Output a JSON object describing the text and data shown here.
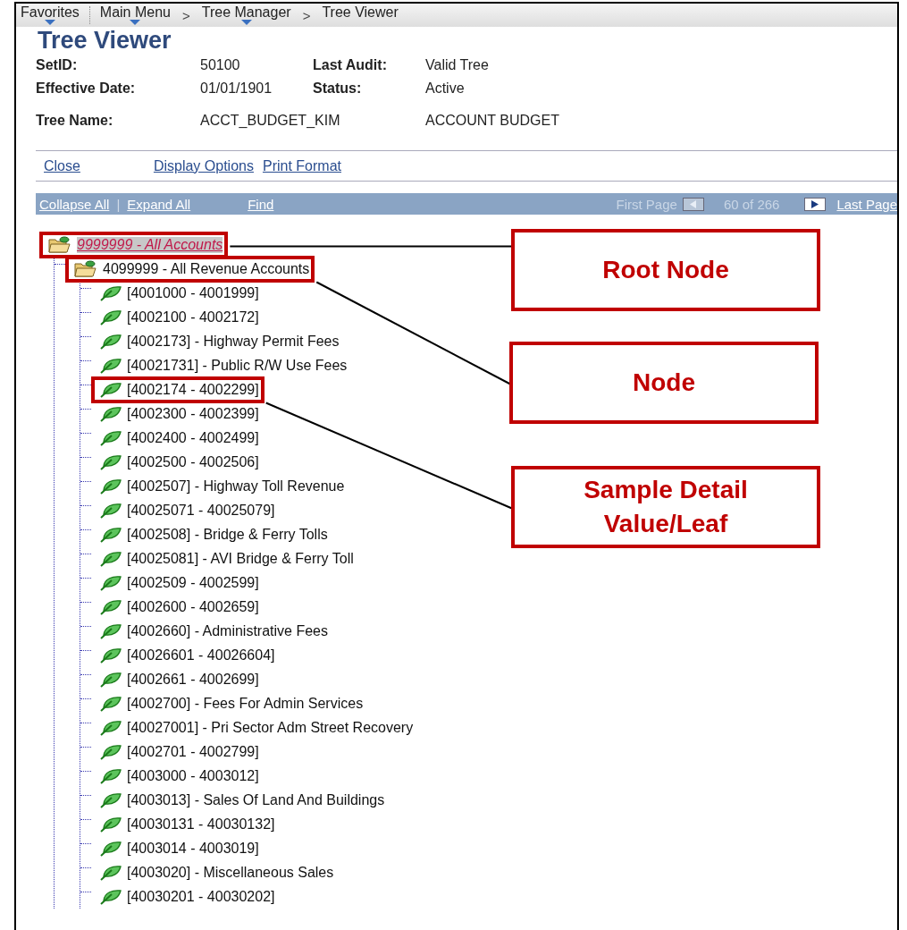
{
  "nav": [
    {
      "label": "Favorites",
      "dropdown": true,
      "divider": true
    },
    {
      "label": "Main Menu",
      "dropdown": true,
      "divider": false,
      "separator": ">"
    },
    {
      "label": "Tree Manager",
      "dropdown": true,
      "divider": false,
      "separator": ">"
    },
    {
      "label": "Tree Viewer",
      "dropdown": false,
      "divider": false
    }
  ],
  "title": "Tree Viewer",
  "fields": [
    {
      "label": "SetID:",
      "value": "50100",
      "label2": "Last Audit:",
      "value2": "Valid Tree"
    },
    {
      "label": "Effective Date:",
      "value": "01/01/1901",
      "label2": "Status:",
      "value2": "Active"
    },
    {
      "label": "Tree Name:",
      "value": "ACCT_BUDGET_KIM",
      "value2": "ACCOUNT BUDGET"
    }
  ],
  "actions": [
    {
      "label": "Close"
    },
    {
      "label": "Display Options"
    },
    {
      "label": "Print Format"
    }
  ],
  "toolbar": {
    "links": [
      {
        "label": "Collapse All"
      },
      {
        "label": "Expand All"
      },
      {
        "label": "Find"
      }
    ],
    "divider": "|",
    "first_page": {
      "label": "First Page",
      "disabled": true
    },
    "prev_disabled": true,
    "counter": "60 of 266",
    "next_disabled": false,
    "last_page": {
      "label": "Last Page",
      "disabled": false
    }
  },
  "tree": {
    "kind": "folder",
    "label": "9999999 - All Accounts",
    "selected": true,
    "highlighted": true,
    "children": [
      {
        "kind": "folder",
        "label": "4099999 - All Revenue Accounts",
        "selected": false,
        "highlighted": true,
        "children": [
          {
            "kind": "leaf",
            "label": "[4001000 - 4001999]",
            "selected": false,
            "highlighted": false
          },
          {
            "kind": "leaf",
            "label": "[4002100 - 4002172]",
            "selected": false,
            "highlighted": false
          },
          {
            "kind": "leaf",
            "label": "[4002173] - Highway Permit Fees",
            "selected": false,
            "highlighted": false
          },
          {
            "kind": "leaf",
            "label": "[40021731] - Public R/W Use Fees",
            "selected": false,
            "highlighted": false
          },
          {
            "kind": "leaf",
            "label": "[4002174 - 4002299]",
            "selected": false,
            "highlighted": true
          },
          {
            "kind": "leaf",
            "label": "[4002300 - 4002399]",
            "selected": false,
            "highlighted": false
          },
          {
            "kind": "leaf",
            "label": "[4002400 - 4002499]",
            "selected": false,
            "highlighted": false
          },
          {
            "kind": "leaf",
            "label": "[4002500 - 4002506]",
            "selected": false,
            "highlighted": false
          },
          {
            "kind": "leaf",
            "label": "[4002507] - Highway Toll Revenue",
            "selected": false,
            "highlighted": false
          },
          {
            "kind": "leaf",
            "label": "[40025071 - 40025079]",
            "selected": false,
            "highlighted": false
          },
          {
            "kind": "leaf",
            "label": "[4002508] - Bridge & Ferry Tolls",
            "selected": false,
            "highlighted": false
          },
          {
            "kind": "leaf",
            "label": "[40025081] - AVI Bridge & Ferry Toll",
            "selected": false,
            "highlighted": false
          },
          {
            "kind": "leaf",
            "label": "[4002509 - 4002599]",
            "selected": false,
            "highlighted": false
          },
          {
            "kind": "leaf",
            "label": "[4002600 - 4002659]",
            "selected": false,
            "highlighted": false
          },
          {
            "kind": "leaf",
            "label": "[4002660] - Administrative Fees",
            "selected": false,
            "highlighted": false
          },
          {
            "kind": "leaf",
            "label": "[40026601 - 40026604]",
            "selected": false,
            "highlighted": false
          },
          {
            "kind": "leaf",
            "label": "[4002661 - 4002699]",
            "selected": false,
            "highlighted": false
          },
          {
            "kind": "leaf",
            "label": "[4002700] - Fees For Admin Services",
            "selected": false,
            "highlighted": false
          },
          {
            "kind": "leaf",
            "label": "[40027001] - Pri Sector Adm Street Recovery",
            "selected": false,
            "highlighted": false
          },
          {
            "kind": "leaf",
            "label": "[4002701 - 4002799]",
            "selected": false,
            "highlighted": false
          },
          {
            "kind": "leaf",
            "label": "[4003000 - 4003012]",
            "selected": false,
            "highlighted": false
          },
          {
            "kind": "leaf",
            "label": "[4003013] - Sales Of Land And Buildings",
            "selected": false,
            "highlighted": false
          },
          {
            "kind": "leaf",
            "label": "[40030131 - 40030132]",
            "selected": false,
            "highlighted": false
          },
          {
            "kind": "leaf",
            "label": "[4003014 - 4003019]",
            "selected": false,
            "highlighted": false
          },
          {
            "kind": "leaf",
            "label": "[4003020] - Miscellaneous Sales",
            "selected": false,
            "highlighted": false
          },
          {
            "kind": "leaf",
            "label": "[40030201 - 40030202]",
            "selected": false,
            "highlighted": false
          }
        ]
      }
    ]
  },
  "callouts": [
    {
      "text": "Root Node"
    },
    {
      "text": "Node"
    },
    {
      "text": "Sample Detail Value/Leaf"
    }
  ]
}
